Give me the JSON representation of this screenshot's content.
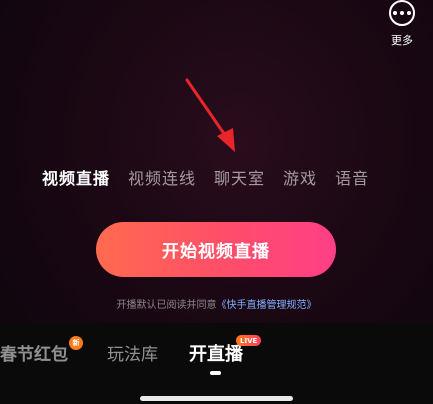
{
  "top_right": {
    "more_label": "更多",
    "more_icon": "more-dots-icon"
  },
  "mode_tabs": [
    {
      "label": "视频直播",
      "active": true
    },
    {
      "label": "视频连线",
      "active": false
    },
    {
      "label": "聊天室",
      "active": false
    },
    {
      "label": "游戏",
      "active": false
    },
    {
      "label": "语音",
      "active": false
    }
  ],
  "start_button": {
    "label": "开始视频直播"
  },
  "agreement": {
    "prefix": "开播默认已阅读并同意",
    "link": "《快手直播管理规范》"
  },
  "bottom_tabs": {
    "hongbao": "春节红包",
    "hongbao_badge": "新",
    "wanfa": "玩法库",
    "live": "开直播",
    "live_badge": "LIVE"
  },
  "colors": {
    "accent_start": "#ff6a4f",
    "accent_end": "#ff3f86",
    "annotation_arrow": "#e8262a",
    "link": "#7fb0ff"
  }
}
